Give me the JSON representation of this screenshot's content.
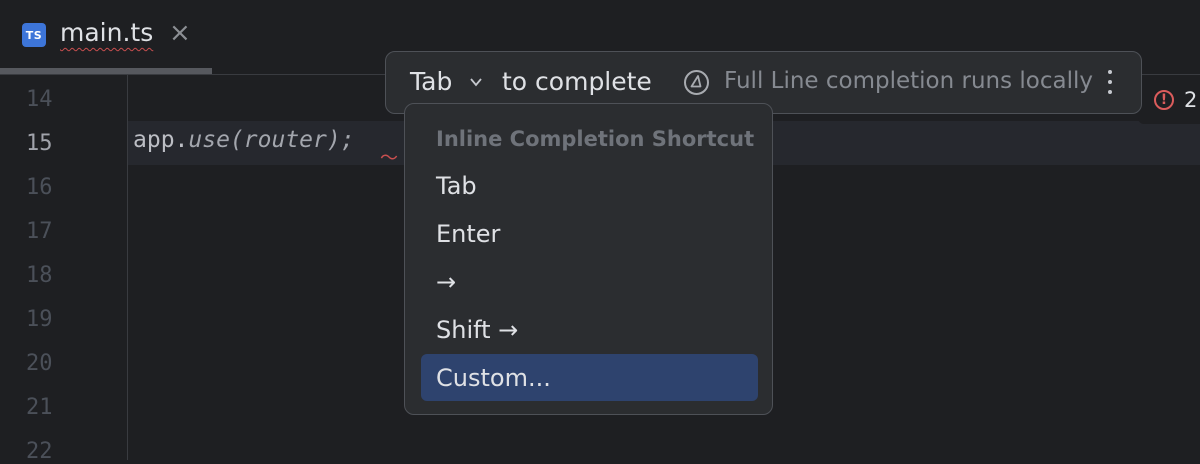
{
  "tab": {
    "icon_label": "TS",
    "title": "main.ts",
    "close_glyph": "×"
  },
  "gutter": {
    "lines": [
      "14",
      "15",
      "16",
      "17",
      "18",
      "19",
      "20",
      "21",
      "22"
    ],
    "current_line": "15"
  },
  "code": {
    "line15_obj": "app.",
    "line15_method": "use",
    "line15_args": "(router);"
  },
  "errors": {
    "count": "2"
  },
  "hint": {
    "key": "Tab",
    "action": "to complete",
    "info": "Full Line completion runs locally"
  },
  "menu": {
    "header": "Inline Completion Shortcut",
    "items": [
      "Tab",
      "Enter",
      "→",
      "Shift →",
      "Custom..."
    ],
    "selected_index": 4
  },
  "colors": {
    "background": "#1e1f22",
    "popup": "#2b2d30",
    "selected": "#2e436e",
    "error": "#db5c5c",
    "ts_badge": "#3d75d9"
  }
}
